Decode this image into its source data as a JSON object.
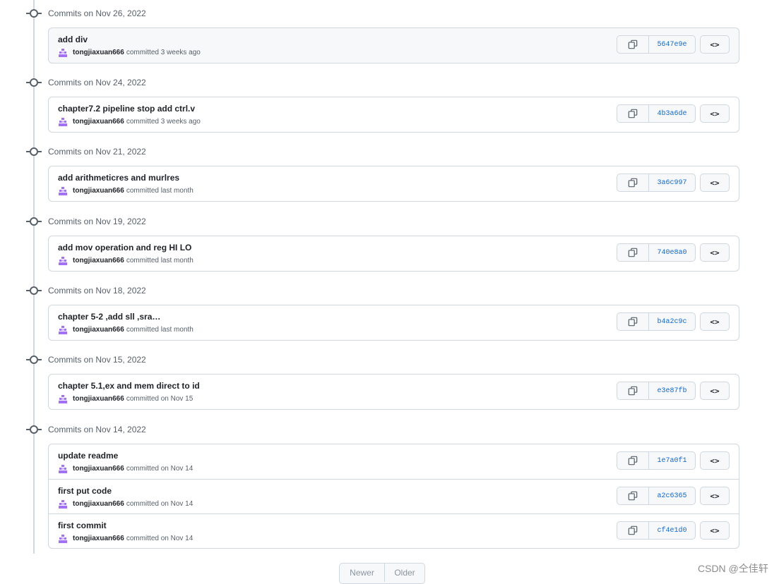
{
  "groups": [
    {
      "title": "Commits on Nov 26, 2022",
      "commits": [
        {
          "message": "add div",
          "author": "tongjiaxuan666",
          "when": "committed 3 weeks ago",
          "sha": "5647e9e"
        }
      ]
    },
    {
      "title": "Commits on Nov 24, 2022",
      "commits": [
        {
          "message": "chapter7.2 pipeline stop add ctrl.v",
          "author": "tongjiaxuan666",
          "when": "committed 3 weeks ago",
          "sha": "4b3a6de"
        }
      ]
    },
    {
      "title": "Commits on Nov 21, 2022",
      "commits": [
        {
          "message": "add arithmeticres and murlres",
          "author": "tongjiaxuan666",
          "when": "committed last month",
          "sha": "3a6c997"
        }
      ]
    },
    {
      "title": "Commits on Nov 19, 2022",
      "commits": [
        {
          "message": "add mov operation and reg HI LO",
          "author": "tongjiaxuan666",
          "when": "committed last month",
          "sha": "740e8a0"
        }
      ]
    },
    {
      "title": "Commits on Nov 18, 2022",
      "commits": [
        {
          "message": "chapter 5-2 ,add sll ,sra…",
          "author": "tongjiaxuan666",
          "when": "committed last month",
          "sha": "b4a2c9c"
        }
      ]
    },
    {
      "title": "Commits on Nov 15, 2022",
      "commits": [
        {
          "message": "chapter 5.1,ex and mem direct to id",
          "author": "tongjiaxuan666",
          "when": "committed on Nov 15",
          "sha": "e3e87fb"
        }
      ]
    },
    {
      "title": "Commits on Nov 14, 2022",
      "commits": [
        {
          "message": "update readme",
          "author": "tongjiaxuan666",
          "when": "committed on Nov 14",
          "sha": "1e7a0f1"
        },
        {
          "message": "first put code",
          "author": "tongjiaxuan666",
          "when": "committed on Nov 14",
          "sha": "a2c6365"
        },
        {
          "message": "first commit",
          "author": "tongjiaxuan666",
          "when": "committed on Nov 14",
          "sha": "cf4e1d0"
        }
      ]
    }
  ],
  "pagination": {
    "newer": "Newer",
    "older": "Older"
  },
  "watermark": "CSDN @仝佳轩",
  "colors": {
    "sha_link": "#0969da",
    "avatar": "#a371f7",
    "border": "#d0d7de"
  },
  "icons": {
    "copy": "copy-icon",
    "browse": "code-icon",
    "avatar": "identicon-avatar"
  }
}
